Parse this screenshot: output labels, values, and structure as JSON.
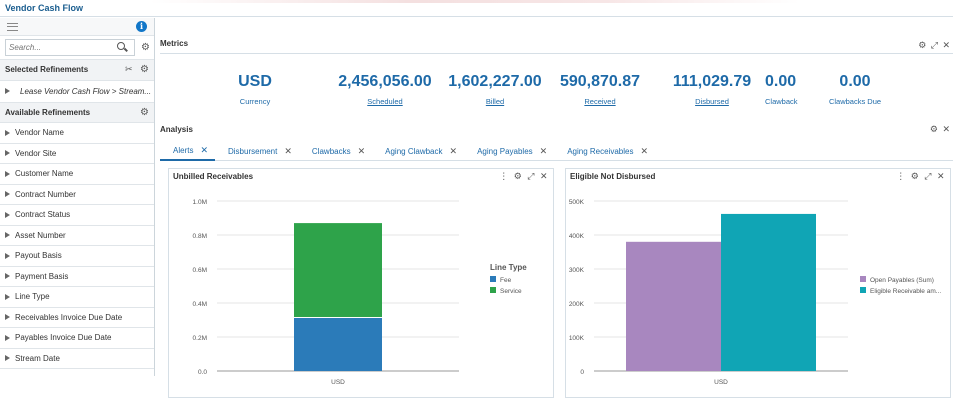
{
  "app": {
    "title": "Vendor Cash Flow"
  },
  "sidebar": {
    "search_placeholder": "Search...",
    "selected_heading": "Selected Refinements",
    "selected_value": "Lease Vendor Cash Flow > Stream...",
    "available_heading": "Available Refinements",
    "items": [
      "Vendor Name",
      "Vendor Site",
      "Customer Name",
      "Contract Number",
      "Contract Status",
      "Asset Number",
      "Payout Basis",
      "Payment Basis",
      "Line Type",
      "Receivables Invoice Due Date",
      "Payables Invoice Due Date",
      "Stream Date"
    ]
  },
  "metrics": {
    "title": "Metrics",
    "items": [
      {
        "value": "USD",
        "label": "Currency",
        "link": false
      },
      {
        "value": "2,456,056.00",
        "label": "Scheduled",
        "link": true
      },
      {
        "value": "1,602,227.00",
        "label": "Billed",
        "link": true
      },
      {
        "value": "590,870.87",
        "label": "Received",
        "link": true
      },
      {
        "value": "111,029.79",
        "label": "Disbursed",
        "link": true
      },
      {
        "value": "0.00",
        "label": "Clawback",
        "link": false
      },
      {
        "value": "0.00",
        "label": "Clawbacks Due",
        "link": false
      }
    ]
  },
  "analysis": {
    "title": "Analysis",
    "tabs": [
      "Alerts",
      "Disbursement",
      "Clawbacks",
      "Aging Clawback",
      "Aging Payables",
      "Aging Receivables"
    ],
    "active_tab": 0
  },
  "chart_data": [
    {
      "type": "bar",
      "stacked": true,
      "title": "Unbilled Receivables",
      "categories": [
        "USD"
      ],
      "series": [
        {
          "name": "Fee",
          "values": [
            315000
          ],
          "color": "#2b7bb9"
        },
        {
          "name": "Service",
          "values": [
            555000
          ],
          "color": "#2ea34a"
        }
      ],
      "ylim": [
        0,
        1000000
      ],
      "yticks": [
        "0.0",
        "0.2M",
        "0.4M",
        "0.6M",
        "0.8M",
        "1.0M"
      ],
      "legend_title": "Line Type",
      "legend_position": "right"
    },
    {
      "type": "bar",
      "stacked": false,
      "title": "Eligible Not Disbursed",
      "categories": [
        "USD"
      ],
      "series": [
        {
          "name": "Open Payables (Sum)",
          "values": [
            380000
          ],
          "color": "#a887bf"
        },
        {
          "name": "Eligible Receivable am...",
          "values": [
            462000
          ],
          "color": "#10a5b5"
        }
      ],
      "ylim": [
        0,
        500000
      ],
      "yticks": [
        "0",
        "100K",
        "200K",
        "300K",
        "400K",
        "500K"
      ],
      "legend_position": "right"
    }
  ]
}
